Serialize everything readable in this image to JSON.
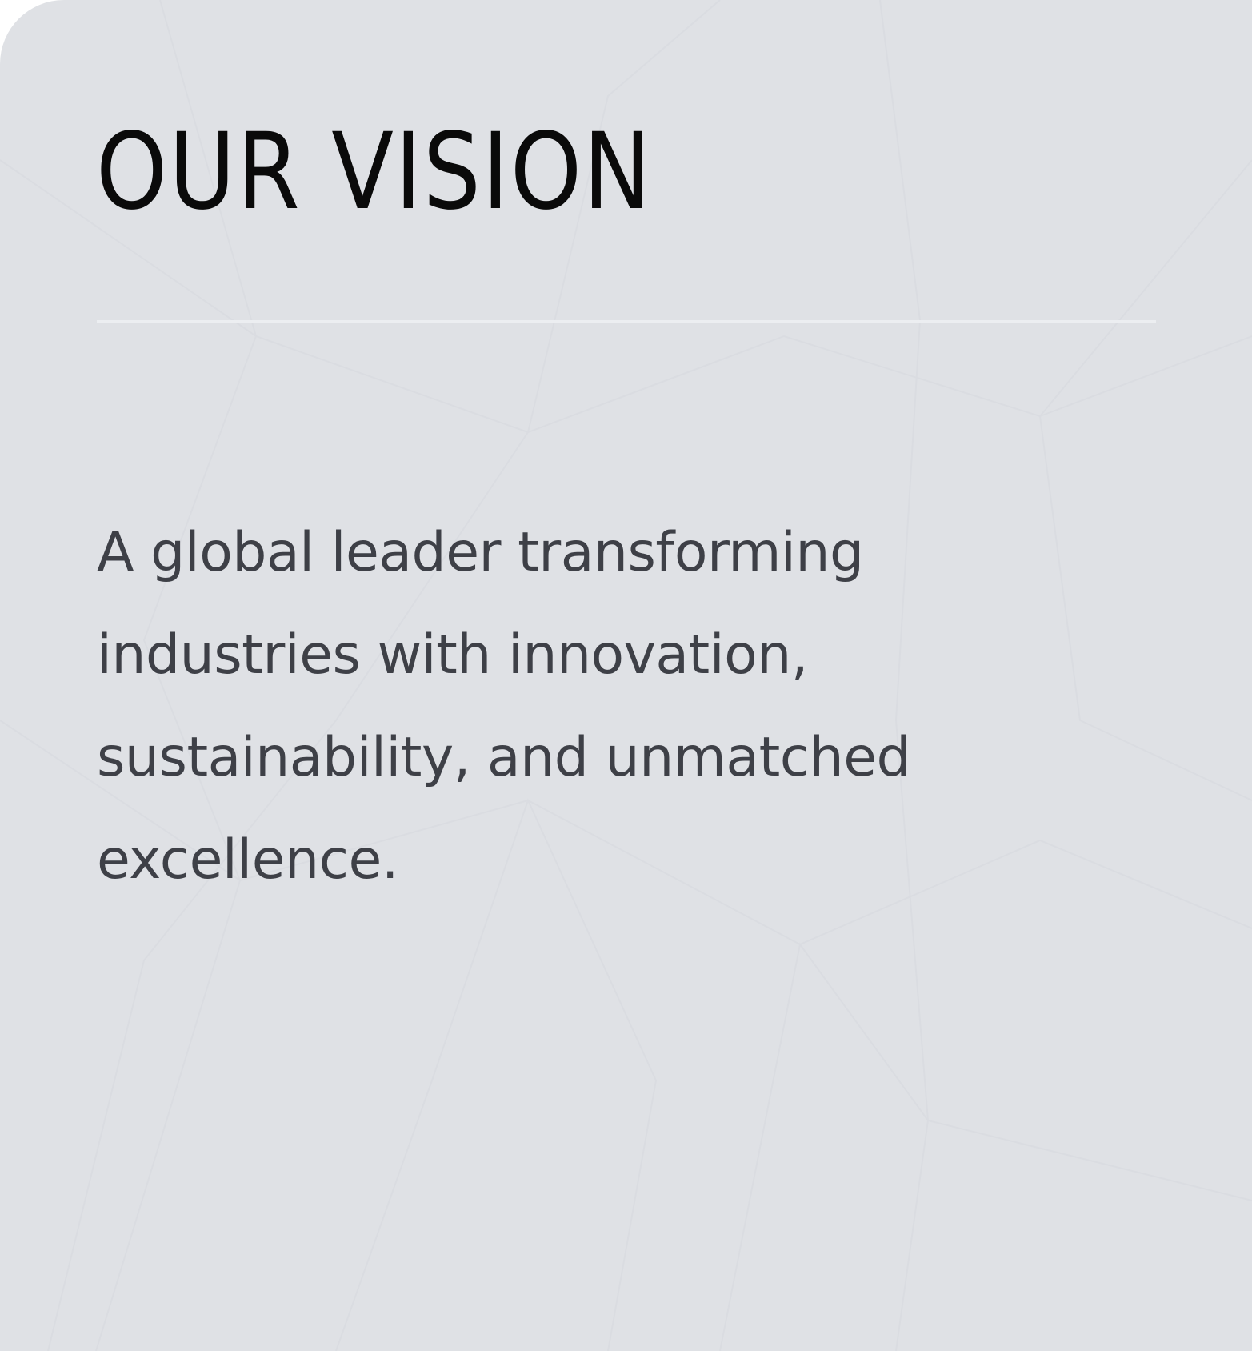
{
  "section": {
    "title": "OUR VISION",
    "body": "A global leader transforming industries with innovation, sustainability, and unmatched excellence."
  },
  "colors": {
    "card_background": "#dfe1e5",
    "title_text": "#0a0a0a",
    "body_text": "#3e4047",
    "divider": "#eceef1"
  }
}
